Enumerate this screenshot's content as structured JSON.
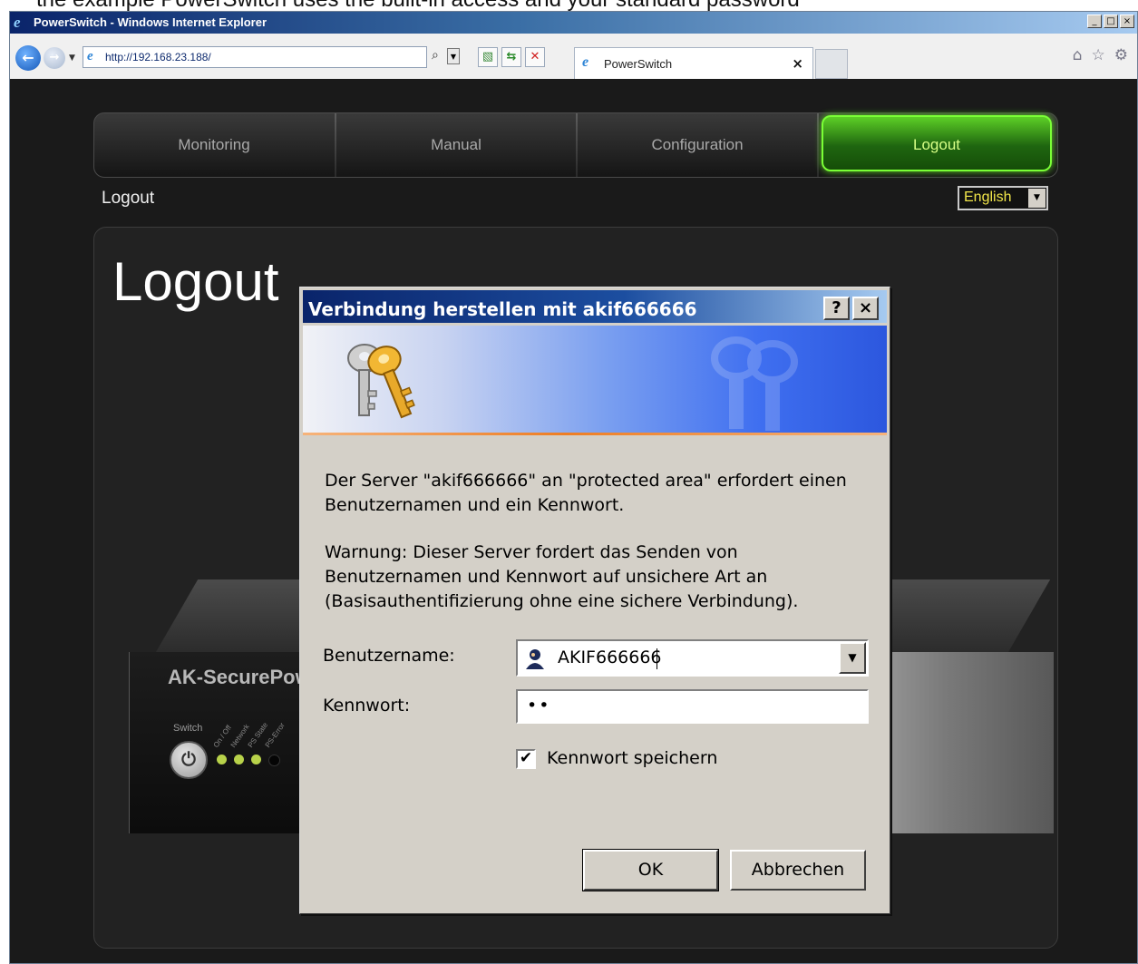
{
  "page_top_text": "the example PowerSwitch uses the built-in access and your standard password",
  "window": {
    "title": "PowerSwitch - Windows Internet Explorer",
    "min_glyph": "_",
    "max_glyph": "□",
    "close_glyph": "×"
  },
  "browser": {
    "url": "http://192.168.23.188/",
    "tab_title": "PowerSwitch",
    "tab_close": "×"
  },
  "site": {
    "nav_tabs": [
      "Monitoring",
      "Manual",
      "Configuration",
      "Logout"
    ],
    "active_tab": "Logout",
    "breadcrumb": "Logout",
    "language": "English",
    "page_heading": "Logout",
    "accent_color": "#5dcf26"
  },
  "device": {
    "brand": "AK-SecurePower",
    "switch_label": "Switch",
    "leds": [
      "On / Off",
      "Network",
      "PS State",
      "PS-Error"
    ]
  },
  "dialog": {
    "title": "Verbindung herstellen mit akif666666",
    "help_glyph": "?",
    "close_glyph": "×",
    "message_line1": "Der Server \"akif666666\" an \"protected area\" erfordert einen",
    "message_line2": "Benutzernamen und ein Kennwort.",
    "warning_line1": "Warnung: Dieser Server fordert das Senden von",
    "warning_line2": "Benutzernamen und Kennwort auf unsichere Art an",
    "warning_line3": "(Basisauthentifizierung ohne eine sichere Verbindung).",
    "username_label": "Benutzername:",
    "username_value": "AKIF666666",
    "password_label": "Kennwort:",
    "password_value": "••",
    "remember_label": "Kennwort speichern",
    "remember_checked": "✔",
    "ok_label": "OK",
    "cancel_label": "Abbrechen"
  }
}
